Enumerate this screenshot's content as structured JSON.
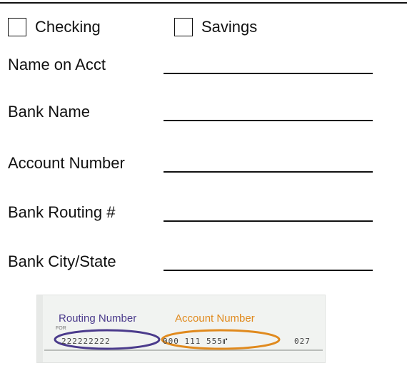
{
  "account_type": {
    "checking_label": "Checking",
    "savings_label": "Savings"
  },
  "fields": [
    {
      "label": "Name on Acct"
    },
    {
      "label": "Bank Name"
    },
    {
      "label": "Account Number"
    },
    {
      "label": "Bank Routing #"
    },
    {
      "label": "Bank City/State"
    }
  ],
  "check_diagram": {
    "routing_label": "Routing Number",
    "account_label": "Account Number",
    "for_text": "FOR",
    "routing_digits": "222222222",
    "account_digits": "000 111 555⑈",
    "check_digits": "027",
    "colors": {
      "routing": "#4b3b8c",
      "account": "#e08a1e"
    }
  }
}
